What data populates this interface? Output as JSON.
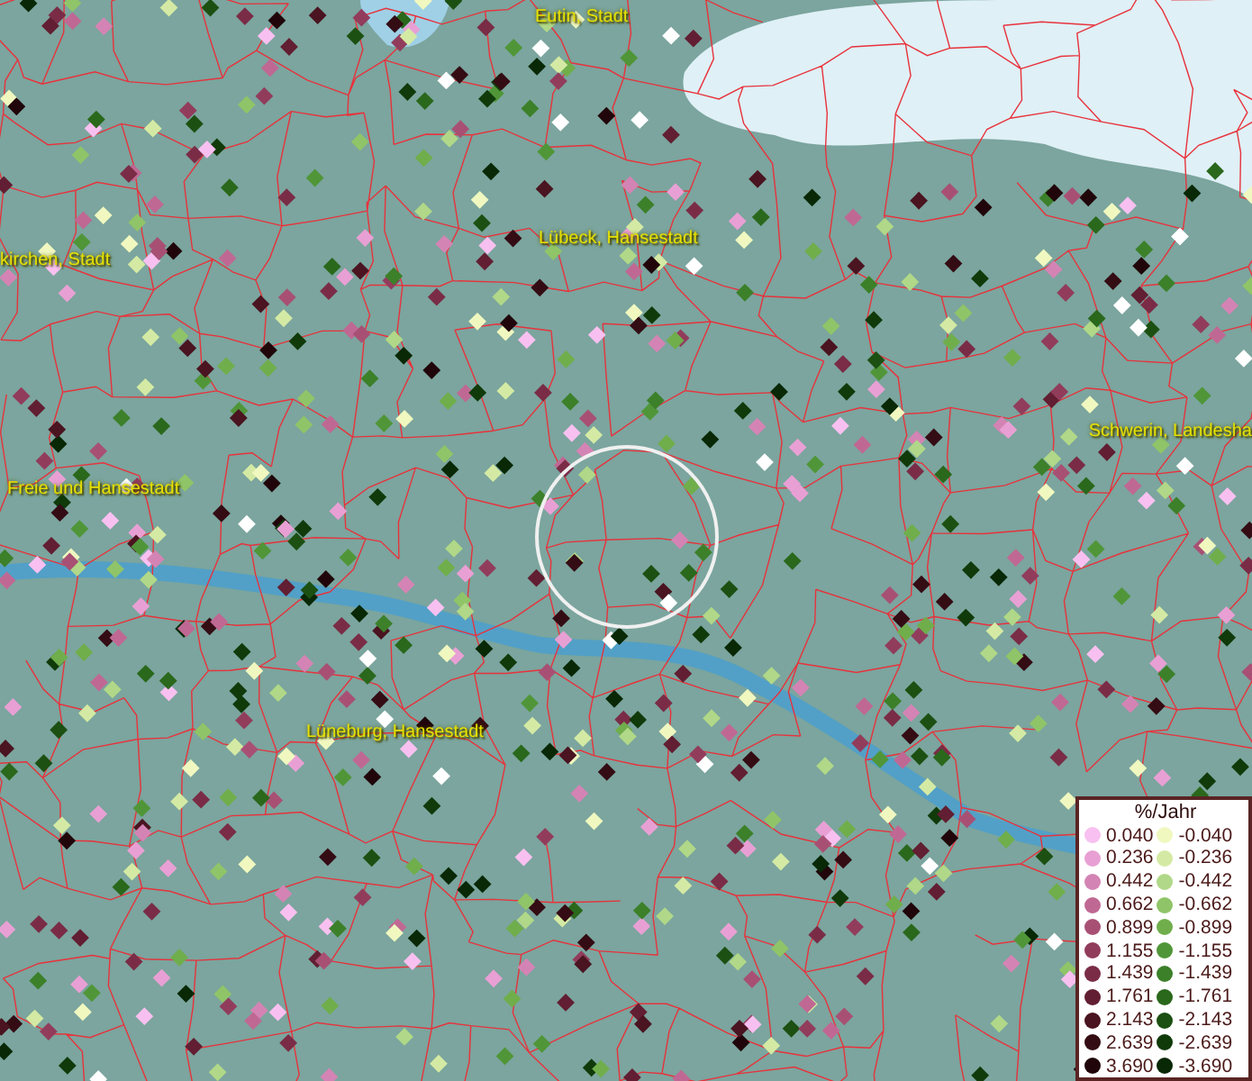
{
  "map": {
    "places": [
      {
        "label": "Eutin, Stadt"
      },
      {
        "label": "Lübeck, Hansestadt"
      },
      {
        "label": "kirchen, Stadt"
      },
      {
        "label": "Freie und Hansestadt"
      },
      {
        "label": "Schwerin, Landesha"
      },
      {
        "label": "Lüneburg, Hansestadt"
      }
    ]
  },
  "legend": {
    "title": "%/Jahr",
    "columns": [
      {
        "items": [
          {
            "label": "0.040",
            "color": "#f8c0f0"
          },
          {
            "label": "0.236",
            "color": "#e8a0d4"
          },
          {
            "label": "0.442",
            "color": "#d484b4"
          },
          {
            "label": "0.662",
            "color": "#c06894"
          },
          {
            "label": "0.899",
            "color": "#a85074"
          },
          {
            "label": "1.155",
            "color": "#923c5c"
          },
          {
            "label": "1.439",
            "color": "#7a2c46"
          },
          {
            "label": "1.761",
            "color": "#621e32"
          },
          {
            "label": "2.143",
            "color": "#4a1420"
          },
          {
            "label": "2.639",
            "color": "#340c14"
          },
          {
            "label": "3.690",
            "color": "#20060a"
          }
        ]
      },
      {
        "items": [
          {
            "label": "-0.040",
            "color": "#f0f8c0"
          },
          {
            "label": "-0.236",
            "color": "#d4eaa4"
          },
          {
            "label": "-0.442",
            "color": "#b0d888"
          },
          {
            "label": "-0.662",
            "color": "#90c468"
          },
          {
            "label": "-0.899",
            "color": "#70ae4c"
          },
          {
            "label": "-1.155",
            "color": "#509638"
          },
          {
            "label": "-1.439",
            "color": "#3c802a"
          },
          {
            "label": "-1.761",
            "color": "#2a681c"
          },
          {
            "label": "-2.143",
            "color": "#1c5012"
          },
          {
            "label": "-2.639",
            "color": "#103a0a"
          },
          {
            "label": "-3.690",
            "color": "#082806"
          }
        ]
      }
    ]
  }
}
